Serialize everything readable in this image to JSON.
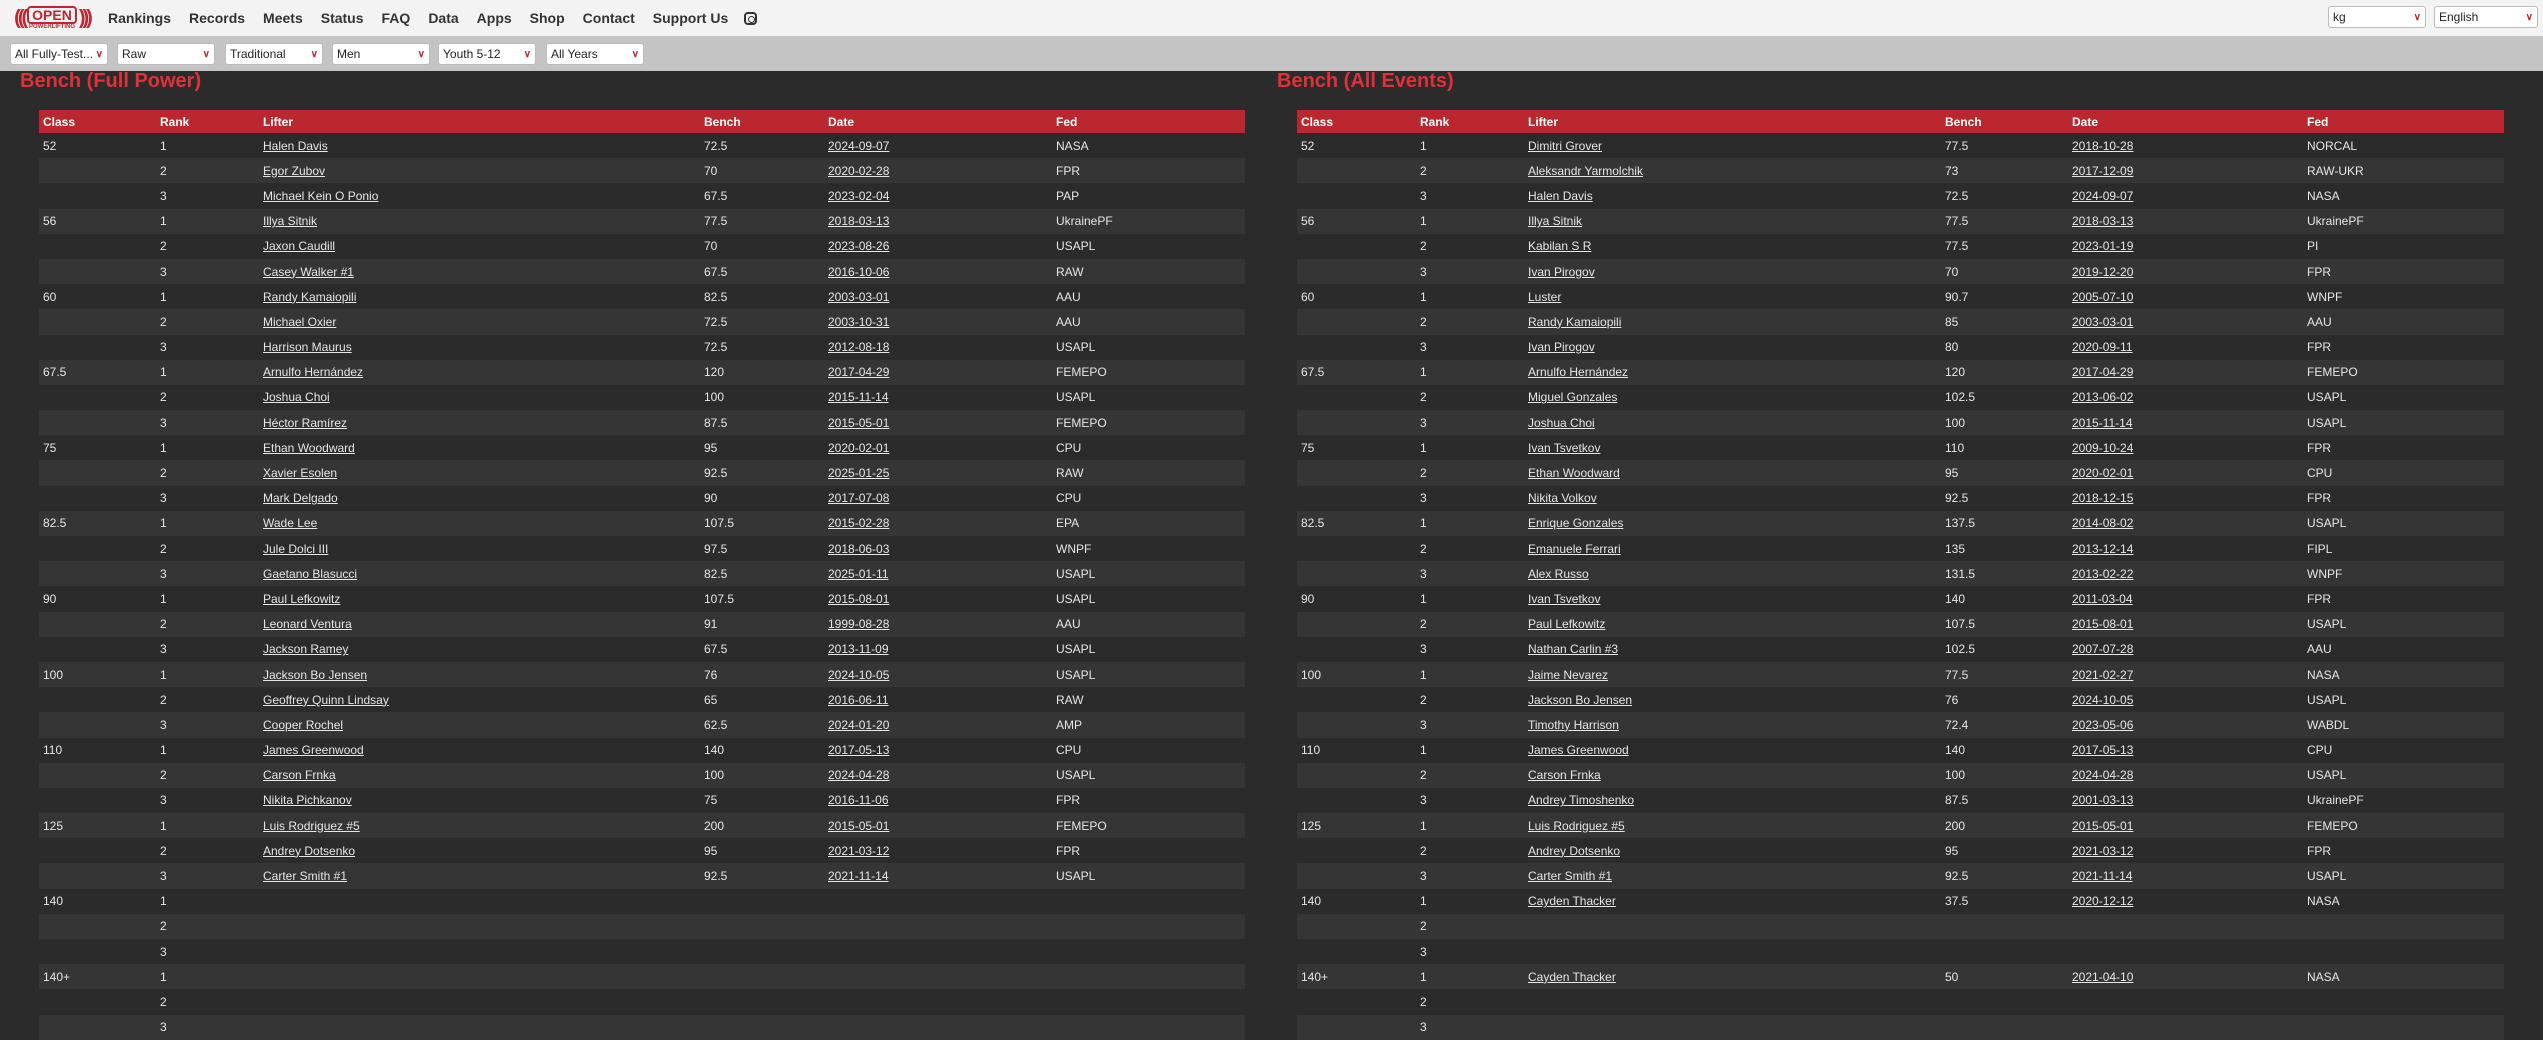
{
  "nav": {
    "logo": "OPEN POWERLIFTING",
    "items": [
      "Rankings",
      "Records",
      "Meets",
      "Status",
      "FAQ",
      "Data",
      "Apps",
      "Shop",
      "Contact",
      "Support Us"
    ],
    "instagram_icon": "instagram-icon"
  },
  "filters": [
    "All Fully-Test...",
    "Raw",
    "Traditional",
    "Men",
    "Youth 5-12",
    "All Years"
  ],
  "units": "kg",
  "language": "English",
  "colors": {
    "accent": "#ba272e",
    "title": "#e0303a",
    "background": "#2b2b2b"
  },
  "columns": [
    "Class",
    "Rank",
    "Lifter",
    "Bench",
    "Date",
    "Fed"
  ],
  "tables": [
    {
      "title": "Bench (Full Power)",
      "rows": [
        [
          "52",
          "1",
          "Halen Davis",
          "72.5",
          "2024-09-07",
          "NASA"
        ],
        [
          "",
          "2",
          "Egor Zubov",
          "70",
          "2020-02-28",
          "FPR"
        ],
        [
          "",
          "3",
          "Michael Kein O Ponio",
          "67.5",
          "2023-02-04",
          "PAP"
        ],
        [
          "56",
          "1",
          "Illya Sitnik",
          "77.5",
          "2018-03-13",
          "UkrainePF"
        ],
        [
          "",
          "2",
          "Jaxon Caudill",
          "70",
          "2023-08-26",
          "USAPL"
        ],
        [
          "",
          "3",
          "Casey Walker #1",
          "67.5",
          "2016-10-06",
          "RAW"
        ],
        [
          "60",
          "1",
          "Randy Kamaiopili",
          "82.5",
          "2003-03-01",
          "AAU"
        ],
        [
          "",
          "2",
          "Michael Oxier",
          "72.5",
          "2003-10-31",
          "AAU"
        ],
        [
          "",
          "3",
          "Harrison Maurus",
          "72.5",
          "2012-08-18",
          "USAPL"
        ],
        [
          "67.5",
          "1",
          "Arnulfo Hernández",
          "120",
          "2017-04-29",
          "FEMEPO"
        ],
        [
          "",
          "2",
          "Joshua Choi",
          "100",
          "2015-11-14",
          "USAPL"
        ],
        [
          "",
          "3",
          "Héctor Ramírez",
          "87.5",
          "2015-05-01",
          "FEMEPO"
        ],
        [
          "75",
          "1",
          "Ethan Woodward",
          "95",
          "2020-02-01",
          "CPU"
        ],
        [
          "",
          "2",
          "Xavier Esolen",
          "92.5",
          "2025-01-25",
          "RAW"
        ],
        [
          "",
          "3",
          "Mark Delgado",
          "90",
          "2017-07-08",
          "CPU"
        ],
        [
          "82.5",
          "1",
          "Wade Lee",
          "107.5",
          "2015-02-28",
          "EPA"
        ],
        [
          "",
          "2",
          "Jule Dolci III",
          "97.5",
          "2018-06-03",
          "WNPF"
        ],
        [
          "",
          "3",
          "Gaetano Blasucci",
          "82.5",
          "2025-01-11",
          "USAPL"
        ],
        [
          "90",
          "1",
          "Paul Lefkowitz",
          "107.5",
          "2015-08-01",
          "USAPL"
        ],
        [
          "",
          "2",
          "Leonard Ventura",
          "91",
          "1999-08-28",
          "AAU"
        ],
        [
          "",
          "3",
          "Jackson Ramey",
          "67.5",
          "2013-11-09",
          "USAPL"
        ],
        [
          "100",
          "1",
          "Jackson Bo Jensen",
          "76",
          "2024-10-05",
          "USAPL"
        ],
        [
          "",
          "2",
          "Geoffrey Quinn Lindsay",
          "65",
          "2016-06-11",
          "RAW"
        ],
        [
          "",
          "3",
          "Cooper Rochel",
          "62.5",
          "2024-01-20",
          "AMP"
        ],
        [
          "110",
          "1",
          "James Greenwood",
          "140",
          "2017-05-13",
          "CPU"
        ],
        [
          "",
          "2",
          "Carson Frnka",
          "100",
          "2024-04-28",
          "USAPL"
        ],
        [
          "",
          "3",
          "Nikita Pichkanov",
          "75",
          "2016-11-06",
          "FPR"
        ],
        [
          "125",
          "1",
          "Luis Rodriguez #5",
          "200",
          "2015-05-01",
          "FEMEPO"
        ],
        [
          "",
          "2",
          "Andrey Dotsenko",
          "95",
          "2021-03-12",
          "FPR"
        ],
        [
          "",
          "3",
          "Carter Smith #1",
          "92.5",
          "2021-11-14",
          "USAPL"
        ],
        [
          "140",
          "1",
          "",
          "",
          "",
          ""
        ],
        [
          "",
          "2",
          "",
          "",
          "",
          ""
        ],
        [
          "",
          "3",
          "",
          "",
          "",
          ""
        ],
        [
          "140+",
          "1",
          "",
          "",
          "",
          ""
        ],
        [
          "",
          "2",
          "",
          "",
          "",
          ""
        ],
        [
          "",
          "3",
          "",
          "",
          "",
          ""
        ]
      ]
    },
    {
      "title": "Bench (All Events)",
      "rows": [
        [
          "52",
          "1",
          "Dimitri Grover",
          "77.5",
          "2018-10-28",
          "NORCAL"
        ],
        [
          "",
          "2",
          "Aleksandr Yarmolchik",
          "73",
          "2017-12-09",
          "RAW-UKR"
        ],
        [
          "",
          "3",
          "Halen Davis",
          "72.5",
          "2024-09-07",
          "NASA"
        ],
        [
          "56",
          "1",
          "Illya Sitnik",
          "77.5",
          "2018-03-13",
          "UkrainePF"
        ],
        [
          "",
          "2",
          "Kabilan S R",
          "77.5",
          "2023-01-19",
          "PI"
        ],
        [
          "",
          "3",
          "Ivan Pirogov",
          "70",
          "2019-12-20",
          "FPR"
        ],
        [
          "60",
          "1",
          "Luster",
          "90.7",
          "2005-07-10",
          "WNPF"
        ],
        [
          "",
          "2",
          "Randy Kamaiopili",
          "85",
          "2003-03-01",
          "AAU"
        ],
        [
          "",
          "3",
          "Ivan Pirogov",
          "80",
          "2020-09-11",
          "FPR"
        ],
        [
          "67.5",
          "1",
          "Arnulfo Hernández",
          "120",
          "2017-04-29",
          "FEMEPO"
        ],
        [
          "",
          "2",
          "Miguel Gonzales",
          "102.5",
          "2013-06-02",
          "USAPL"
        ],
        [
          "",
          "3",
          "Joshua Choi",
          "100",
          "2015-11-14",
          "USAPL"
        ],
        [
          "75",
          "1",
          "Ivan Tsvetkov",
          "110",
          "2009-10-24",
          "FPR"
        ],
        [
          "",
          "2",
          "Ethan Woodward",
          "95",
          "2020-02-01",
          "CPU"
        ],
        [
          "",
          "3",
          "Nikita Volkov",
          "92.5",
          "2018-12-15",
          "FPR"
        ],
        [
          "82.5",
          "1",
          "Enrique Gonzales",
          "137.5",
          "2014-08-02",
          "USAPL"
        ],
        [
          "",
          "2",
          "Emanuele Ferrari",
          "135",
          "2013-12-14",
          "FIPL"
        ],
        [
          "",
          "3",
          "Alex Russo",
          "131.5",
          "2013-02-22",
          "WNPF"
        ],
        [
          "90",
          "1",
          "Ivan Tsvetkov",
          "140",
          "2011-03-04",
          "FPR"
        ],
        [
          "",
          "2",
          "Paul Lefkowitz",
          "107.5",
          "2015-08-01",
          "USAPL"
        ],
        [
          "",
          "3",
          "Nathan Carlin #3",
          "102.5",
          "2007-07-28",
          "AAU"
        ],
        [
          "100",
          "1",
          "Jaime Nevarez",
          "77.5",
          "2021-02-27",
          "NASA"
        ],
        [
          "",
          "2",
          "Jackson Bo Jensen",
          "76",
          "2024-10-05",
          "USAPL"
        ],
        [
          "",
          "3",
          "Timothy Harrison",
          "72.4",
          "2023-05-06",
          "WABDL"
        ],
        [
          "110",
          "1",
          "James Greenwood",
          "140",
          "2017-05-13",
          "CPU"
        ],
        [
          "",
          "2",
          "Carson Frnka",
          "100",
          "2024-04-28",
          "USAPL"
        ],
        [
          "",
          "3",
          "Andrey Timoshenko",
          "87.5",
          "2001-03-13",
          "UkrainePF"
        ],
        [
          "125",
          "1",
          "Luis Rodriguez #5",
          "200",
          "2015-05-01",
          "FEMEPO"
        ],
        [
          "",
          "2",
          "Andrey Dotsenko",
          "95",
          "2021-03-12",
          "FPR"
        ],
        [
          "",
          "3",
          "Carter Smith #1",
          "92.5",
          "2021-11-14",
          "USAPL"
        ],
        [
          "140",
          "1",
          "Cayden Thacker",
          "37.5",
          "2020-12-12",
          "NASA"
        ],
        [
          "",
          "2",
          "",
          "",
          "",
          ""
        ],
        [
          "",
          "3",
          "",
          "",
          "",
          ""
        ],
        [
          "140+",
          "1",
          "Cayden Thacker",
          "50",
          "2021-04-10",
          "NASA"
        ],
        [
          "",
          "2",
          "",
          "",
          "",
          ""
        ],
        [
          "",
          "3",
          "",
          "",
          "",
          ""
        ]
      ]
    }
  ]
}
